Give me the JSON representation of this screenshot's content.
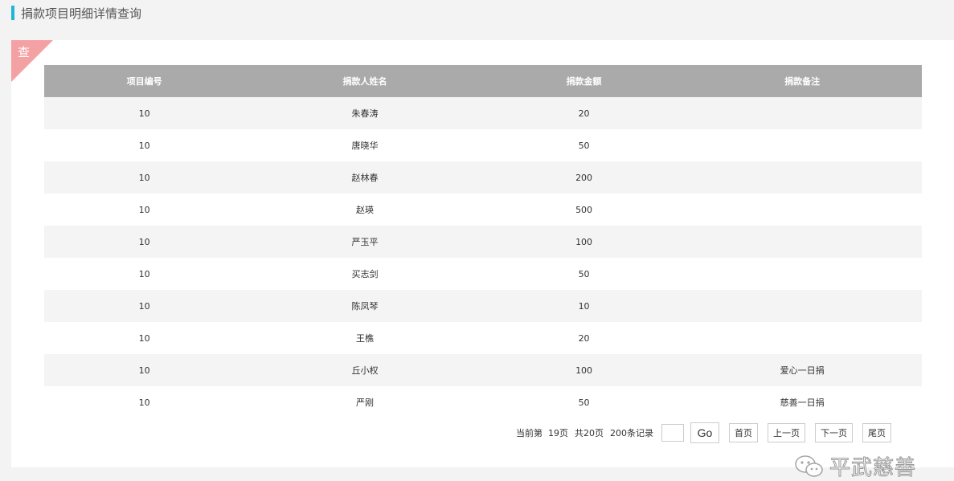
{
  "header": {
    "title": "捐款项目明细详情查询"
  },
  "panel": {
    "corner_label": "查"
  },
  "table": {
    "columns": [
      "项目编号",
      "捐款人姓名",
      "捐款金额",
      "捐款备注"
    ],
    "rows": [
      [
        "10",
        "朱春涛",
        "20",
        ""
      ],
      [
        "10",
        "唐晓华",
        "50",
        ""
      ],
      [
        "10",
        "赵林春",
        "200",
        ""
      ],
      [
        "10",
        "赵瑛",
        "500",
        ""
      ],
      [
        "10",
        "严玉平",
        "100",
        ""
      ],
      [
        "10",
        "买志剑",
        "50",
        ""
      ],
      [
        "10",
        "陈凤琴",
        "10",
        ""
      ],
      [
        "10",
        "王樵",
        "20",
        ""
      ],
      [
        "10",
        "丘小权",
        "100",
        "爱心一日捐"
      ],
      [
        "10",
        "严刚",
        "50",
        "慈善一日捐"
      ]
    ]
  },
  "pagination": {
    "current_text": "当前第  19页",
    "total_pages_text": "共20页",
    "records_text": "200条记录",
    "page_input_value": "",
    "go_label": "Go",
    "first_label": "首页",
    "prev_label": "上一页",
    "next_label": "下一页",
    "last_label": "尾页"
  },
  "watermark": {
    "text": "平武慈善",
    "icon": "wechat-icon"
  },
  "colors": {
    "accent": "#1fb6d6",
    "corner": "#f4a1a4",
    "table_header": "#aaaaaa",
    "row_alt": "#f4f4f4"
  }
}
